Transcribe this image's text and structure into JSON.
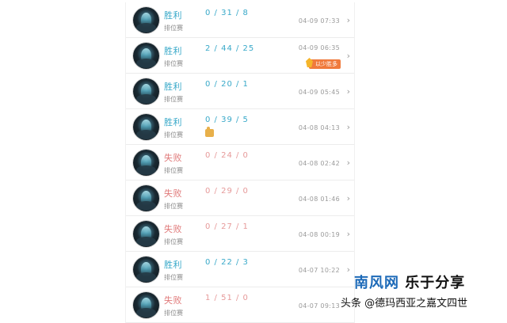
{
  "matches": [
    {
      "result": "胜利",
      "mode": "排位赛",
      "kda": "0 / 31 / 8",
      "time": "04-09 07:33",
      "outcome": "win",
      "badge": "",
      "icon": ""
    },
    {
      "result": "胜利",
      "mode": "排位赛",
      "kda": "2 / 44 / 25",
      "time": "04-09 06:35",
      "outcome": "win",
      "badge": "以少胜多",
      "icon": ""
    },
    {
      "result": "胜利",
      "mode": "排位赛",
      "kda": "0 / 20 / 1",
      "time": "04-09 05:45",
      "outcome": "win",
      "badge": "",
      "icon": ""
    },
    {
      "result": "胜利",
      "mode": "排位赛",
      "kda": "0 / 39 / 5",
      "time": "04-08 04:13",
      "outcome": "win",
      "badge": "",
      "icon": "thumb-up-icon"
    },
    {
      "result": "失败",
      "mode": "排位赛",
      "kda": "0 / 24 / 0",
      "time": "04-08 02:42",
      "outcome": "lose",
      "badge": "",
      "icon": ""
    },
    {
      "result": "失败",
      "mode": "排位赛",
      "kda": "0 / 29 / 0",
      "time": "04-08 01:46",
      "outcome": "lose",
      "badge": "",
      "icon": ""
    },
    {
      "result": "失败",
      "mode": "排位赛",
      "kda": "0 / 27 / 1",
      "time": "04-08 00:19",
      "outcome": "lose",
      "badge": "",
      "icon": ""
    },
    {
      "result": "胜利",
      "mode": "排位赛",
      "kda": "0 / 22 / 3",
      "time": "04-07 10:22",
      "outcome": "win",
      "badge": "",
      "icon": ""
    },
    {
      "result": "失败",
      "mode": "排位赛",
      "kda": "1 / 51 / 0",
      "time": "04-07 09:13",
      "outcome": "lose",
      "badge": "",
      "icon": ""
    }
  ],
  "watermark": {
    "brand_a": "南风网",
    "brand_b": "乐于分享",
    "credit": "头条 @德玛西亚之嘉文四世"
  },
  "colors": {
    "win": "#39a9c9",
    "lose": "#e07a7a",
    "badge": "#f07a3c",
    "brand": "#1d6ab8"
  }
}
